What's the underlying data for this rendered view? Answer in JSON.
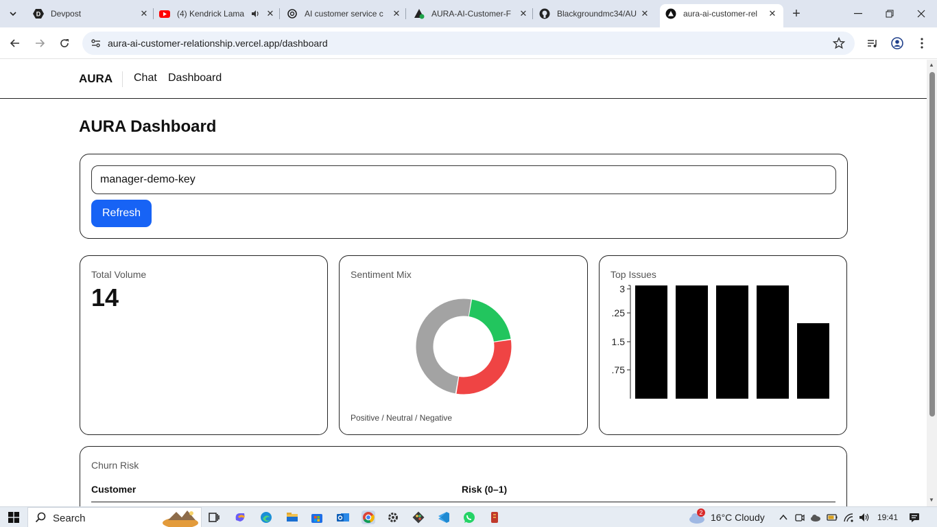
{
  "browser": {
    "tabs": [
      {
        "title": "Devpost",
        "icon": "devpost-icon"
      },
      {
        "title": "(4) Kendrick Lama",
        "icon": "youtube-icon",
        "audio": true
      },
      {
        "title": "AI customer service c",
        "icon": "openai-icon"
      },
      {
        "title": "AURA-AI-Customer-F",
        "icon": "vercel-project-icon"
      },
      {
        "title": "Blackgroundmc34/AU",
        "icon": "github-icon"
      },
      {
        "title": "aura-ai-customer-rel",
        "icon": "vercel-icon",
        "active": true
      }
    ],
    "url": "aura-ai-customer-relationship.vercel.app/dashboard"
  },
  "app": {
    "brand": "AURA",
    "nav": [
      "Chat",
      "Dashboard"
    ],
    "page_title": "AURA Dashboard",
    "api_key": {
      "value": "manager-demo-key",
      "placeholder": ""
    },
    "refresh_label": "Refresh",
    "volume": {
      "label": "Total Volume",
      "value": "14"
    },
    "sentiment": {
      "label": "Sentiment Mix",
      "note": "Positive / Neutral / Negative"
    },
    "top_issues": {
      "label": "Top Issues"
    },
    "churn": {
      "label": "Churn Risk",
      "columns": [
        "Customer",
        "Risk (0–1)"
      ]
    }
  },
  "chart_data": [
    {
      "type": "pie",
      "donut": true,
      "slices": [
        {
          "value": 0.2,
          "color": "#22c55e"
        },
        {
          "value": 0.3,
          "color": "#ef4444"
        },
        {
          "value": 0.5,
          "color": "#a3a3a3"
        }
      ]
    },
    {
      "type": "bar",
      "values": [
        3,
        3,
        3,
        3,
        2
      ],
      "ylim": [
        0,
        3
      ],
      "ytick_labels": [
        "3",
        ".25",
        "1.5",
        ".75"
      ],
      "bar_color": "#000000"
    }
  ],
  "taskbar": {
    "search_label": "Search",
    "weather": "16°C  Cloudy",
    "notification_count": "2",
    "time": "19:41"
  },
  "colors": {
    "accent": "#1763f5",
    "border": "#222222"
  }
}
